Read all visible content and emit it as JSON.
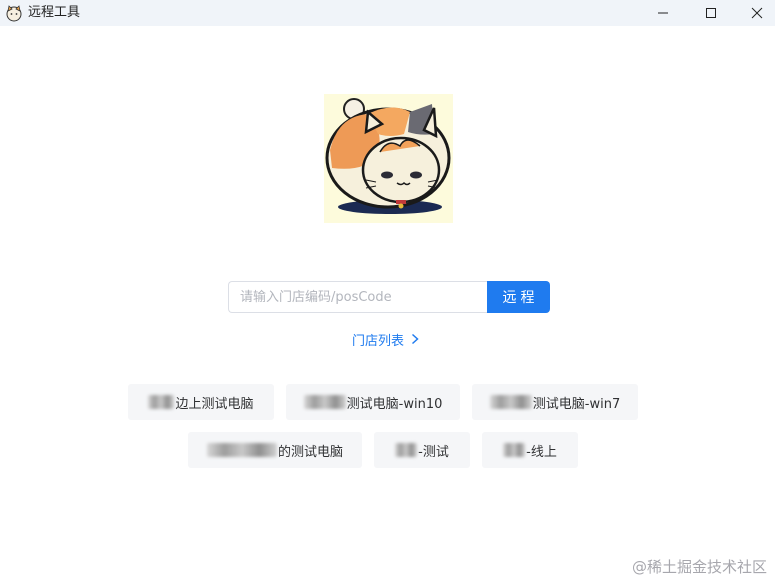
{
  "window": {
    "title": "远程工具",
    "icon": "cat-icon",
    "controls": [
      "minimize-icon",
      "maximize-icon",
      "close-icon"
    ]
  },
  "logo": {
    "icon": "cat-mascot-image"
  },
  "search": {
    "placeholder": "请输入门店编码/posCode",
    "value": "",
    "button_label": "远程"
  },
  "store_list": {
    "label": "门店列表",
    "icon": "chevron-right-icon"
  },
  "devices": [
    {
      "label": "边上测试电脑"
    },
    {
      "label": "测试电脑-win10"
    },
    {
      "label": "测试电脑-win7"
    },
    {
      "label": "的测试电脑"
    },
    {
      "label": "-测试"
    },
    {
      "label": "-线上"
    }
  ],
  "watermark": "@稀土掘金技术社区",
  "colors": {
    "accent": "#1f7bef",
    "titlebar": "#f0f4f9",
    "chip": "#f5f6f8"
  }
}
